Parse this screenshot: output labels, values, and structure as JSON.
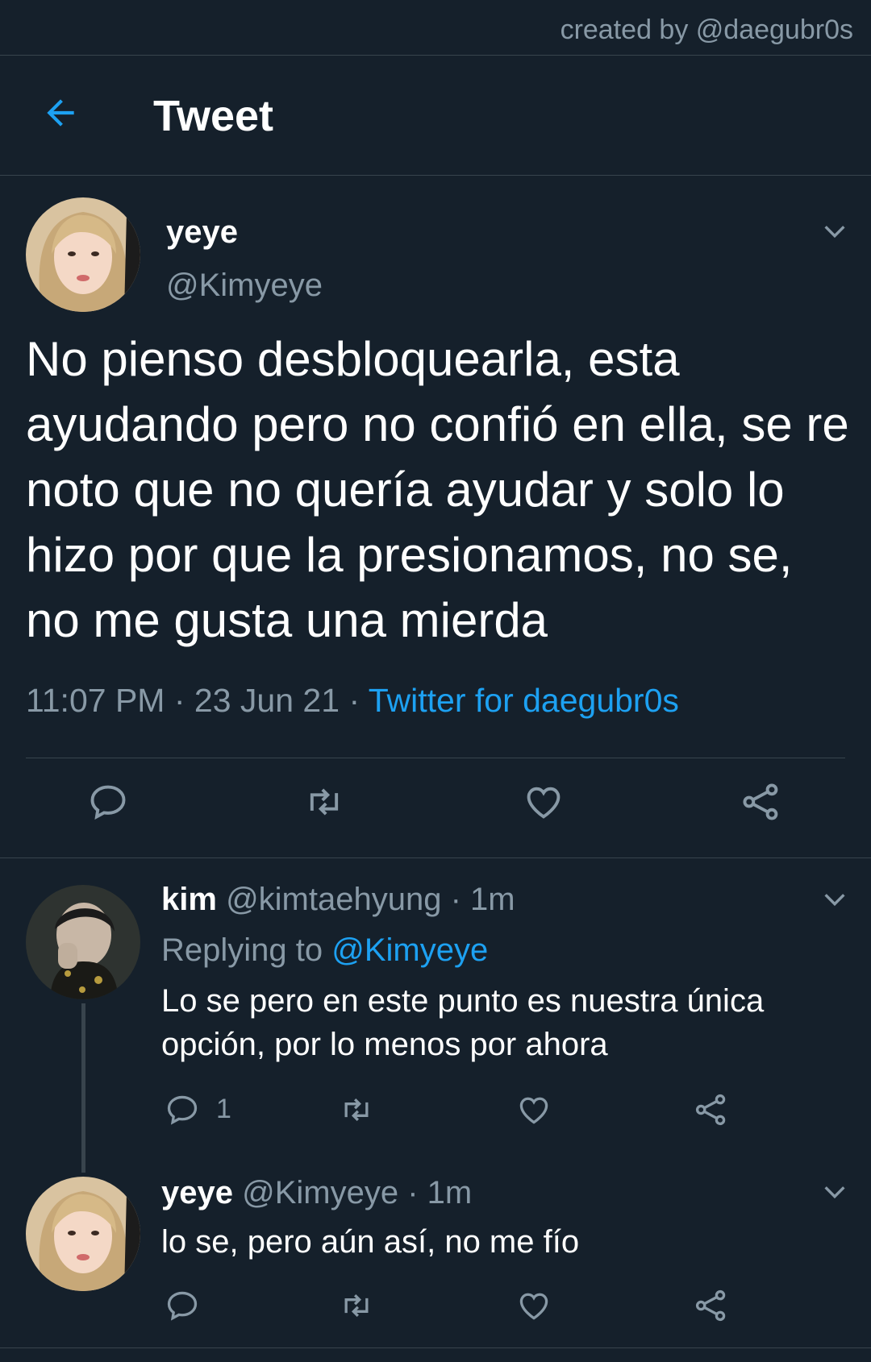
{
  "credit": "created by @daegubr0s",
  "header": {
    "title": "Tweet"
  },
  "tweet": {
    "name": "yeye",
    "handle": "@Kimyeye",
    "text": "No pienso desbloquearla, esta ayudando pero no confió en ella, se re noto que no quería ayudar y solo lo hizo por que la presionamos, no se, no me gusta una mierda",
    "time": "11:07 PM",
    "date": "23 Jun 21",
    "separator": "·",
    "source": "Twitter for daegubr0s"
  },
  "replies": [
    {
      "name": "kim",
      "handle": "@kimtaehyung",
      "separator": "·",
      "time": "1m",
      "replying_prefix": "Replying to",
      "replying_to": "@Kimyeye",
      "text": "Lo se pero en este punto es nuestra única opción, por lo menos por ahora",
      "reply_count": "1"
    },
    {
      "name": "yeye",
      "handle": "@Kimyeye",
      "separator": "·",
      "time": "1m",
      "text": "lo se, pero aún así, no me fío"
    }
  ],
  "colors": {
    "background": "#15202b",
    "accent": "#1da1f2",
    "muted": "#8899a6",
    "divider": "#38444d"
  },
  "icons": [
    "back-arrow-icon",
    "chevron-down-icon",
    "reply-icon",
    "retweet-icon",
    "like-icon",
    "share-icon"
  ]
}
